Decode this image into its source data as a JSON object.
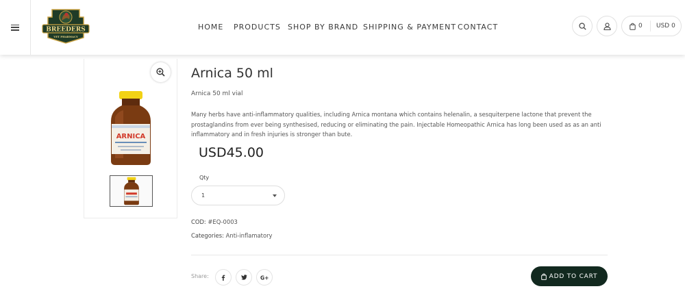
{
  "header": {
    "logo": {
      "brand": "BREEDERS",
      "tagline": "VET PHARMACY"
    },
    "nav": [
      "HOME",
      "PRODUCTS",
      "SHOP BY BRAND",
      "SHIPPING & PAYMENT",
      "CONTACT"
    ],
    "cart_count": "0",
    "currency": "USD 0"
  },
  "product": {
    "title": "Arnica 50 ml",
    "subtitle": "Arnica 50 ml vial",
    "description": "Many herbs have anti-inflammatory qualities, including Arnica montana which contains helenalin, a sesquiterpene lactone that prevent the prostaglandins from ever being synthesised, reducing or eliminating the pain. Injectable Homeopathic Arnica has long been used as as an anti inflammatory and in fresh injuries is stronger than bute.",
    "price": "USD45.00",
    "qty_label": "Qty",
    "qty_value": "1",
    "cod_label": "COD:",
    "cod_value": "#EQ-0003",
    "categories_label": "Categories",
    "categories_value": "Anti-inflamatory",
    "share_label": "Share:",
    "add_to_cart": "ADD TO CART",
    "bottle_label": "ARNICA"
  },
  "colors": {
    "accent": "#12291f",
    "cap": "#f2d215",
    "bottle": "#7a3b12"
  }
}
